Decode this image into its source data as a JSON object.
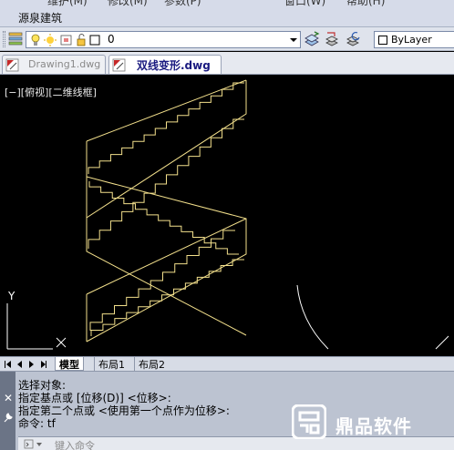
{
  "menubar": {
    "items": [
      "维护(M)",
      "修改(M)",
      "参数(P)",
      "窗口(W)",
      "帮助(H)"
    ],
    "custom_menu": "源泉建筑"
  },
  "layer_toolbar": {
    "current_layer": "0",
    "color_value": "ByLayer"
  },
  "doc_tabs": [
    {
      "label": "Drawing1.dwg",
      "active": false
    },
    {
      "label": "双线变形.dwg",
      "active": true
    }
  ],
  "viewport": {
    "label": "[−][俯视][二维线框]"
  },
  "ucs": {
    "y_axis_label": "Y"
  },
  "layout_tabs": [
    "模型",
    "布局1",
    "布局2"
  ],
  "command_window": {
    "history": [
      "选择对象:",
      "指定基点或 [位移(D)] <位移>:",
      "指定第二个点或 <使用第一个点作为位移>:",
      "命令: tf"
    ],
    "input_placeholder": "键入命令"
  },
  "watermark": {
    "brand": "鼎品软件"
  },
  "colors": {
    "drawing_lines": "#f3e08c",
    "canvas_bg": "#000000",
    "ui_panel": "#d6dbe9"
  }
}
